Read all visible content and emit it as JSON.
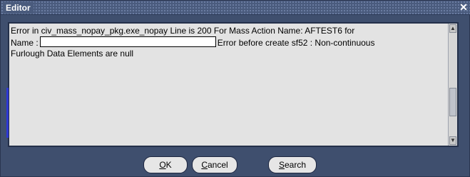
{
  "window": {
    "title": "Editor"
  },
  "message": {
    "line1": "Error in civ_mass_nopay_pkg.exe_nopay Line is 200  For Mass Action Name: AFTEST6 for",
    "line2_prefix": "Name :",
    "line2_suffix": "Error before create sf52 : Non-continuous",
    "line3": "Furlough Data Elements are null"
  },
  "buttons": {
    "ok_mnemonic": "O",
    "ok_rest": "K",
    "cancel_mnemonic": "C",
    "cancel_rest": "ancel",
    "search_mnemonic": "S",
    "search_rest": "earch"
  },
  "icons": {
    "close": "✕",
    "scroll_up": "▲",
    "scroll_down": "▼"
  }
}
